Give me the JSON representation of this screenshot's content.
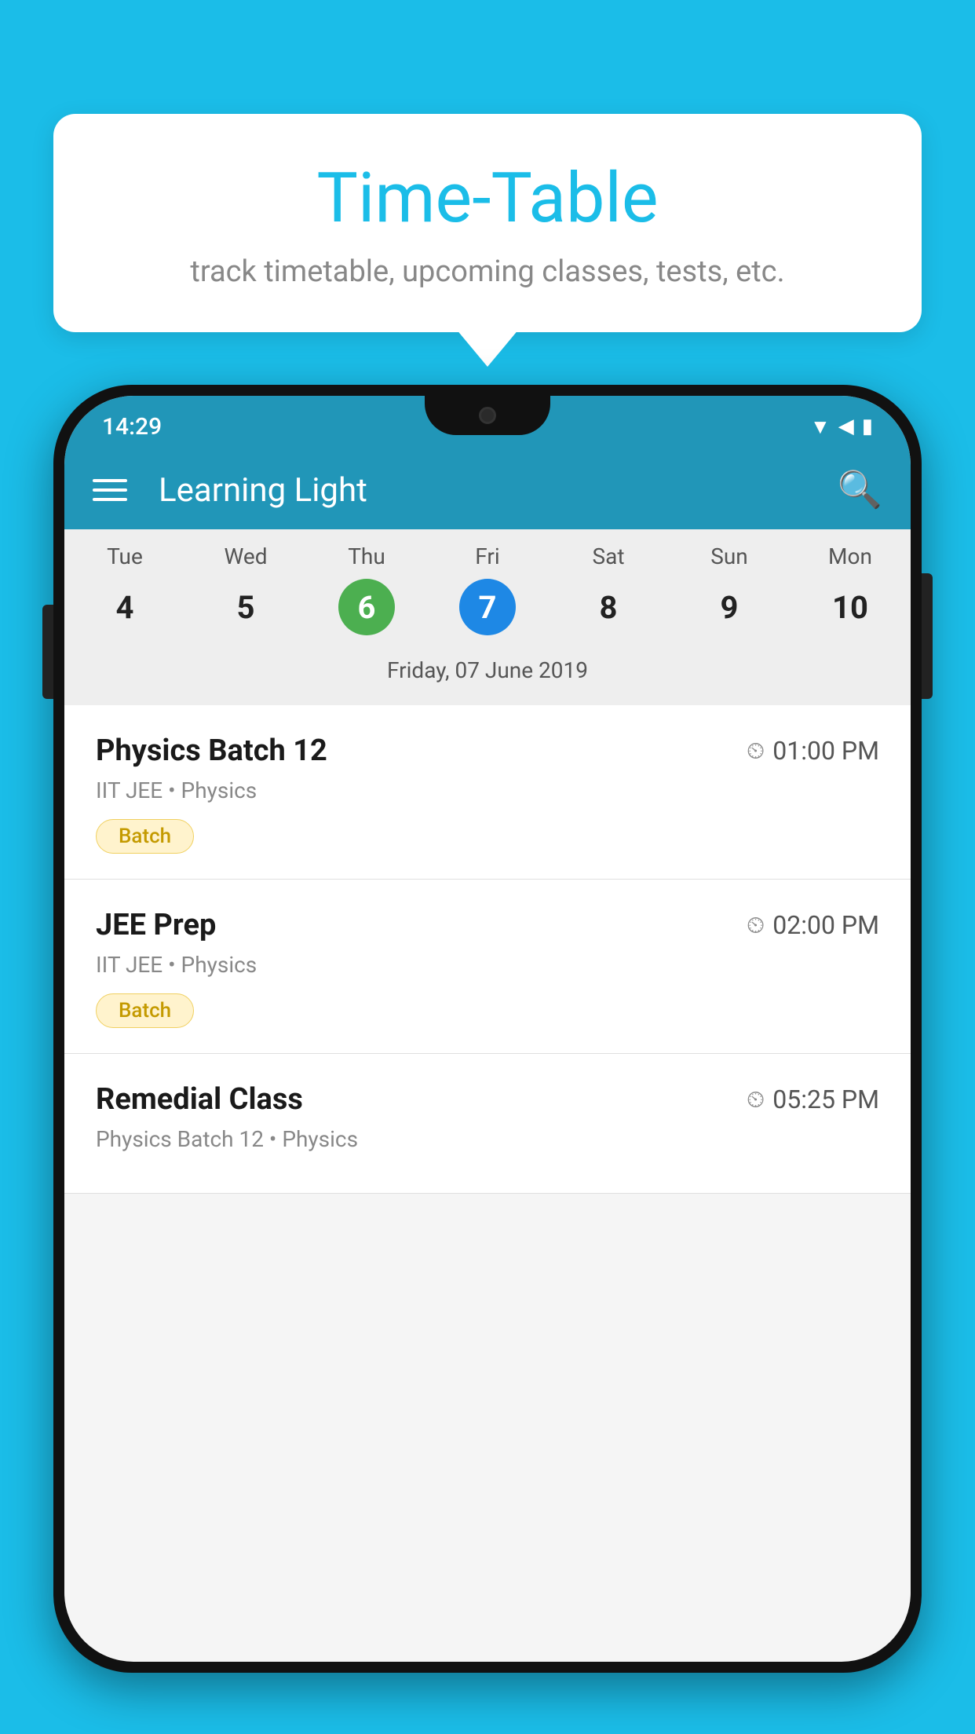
{
  "background_color": "#1BBDE8",
  "tooltip": {
    "title": "Time-Table",
    "subtitle": "track timetable, upcoming classes, tests, etc."
  },
  "phone": {
    "status_bar": {
      "time": "14:29"
    },
    "app_bar": {
      "title": "Learning Light"
    },
    "calendar": {
      "weekdays": [
        "Tue",
        "Wed",
        "Thu",
        "Fri",
        "Sat",
        "Sun",
        "Mon"
      ],
      "dates": [
        {
          "value": "4",
          "type": "normal"
        },
        {
          "value": "5",
          "type": "normal"
        },
        {
          "value": "6",
          "type": "green"
        },
        {
          "value": "7",
          "type": "blue"
        },
        {
          "value": "8",
          "type": "normal"
        },
        {
          "value": "9",
          "type": "normal"
        },
        {
          "value": "10",
          "type": "normal"
        }
      ],
      "selected_date": "Friday, 07 June 2019"
    },
    "schedule": [
      {
        "title": "Physics Batch 12",
        "time": "01:00 PM",
        "meta": "IIT JEE • Physics",
        "badge": "Batch"
      },
      {
        "title": "JEE Prep",
        "time": "02:00 PM",
        "meta": "IIT JEE • Physics",
        "badge": "Batch"
      },
      {
        "title": "Remedial Class",
        "time": "05:25 PM",
        "meta": "Physics Batch 12 • Physics",
        "badge": null
      }
    ]
  }
}
